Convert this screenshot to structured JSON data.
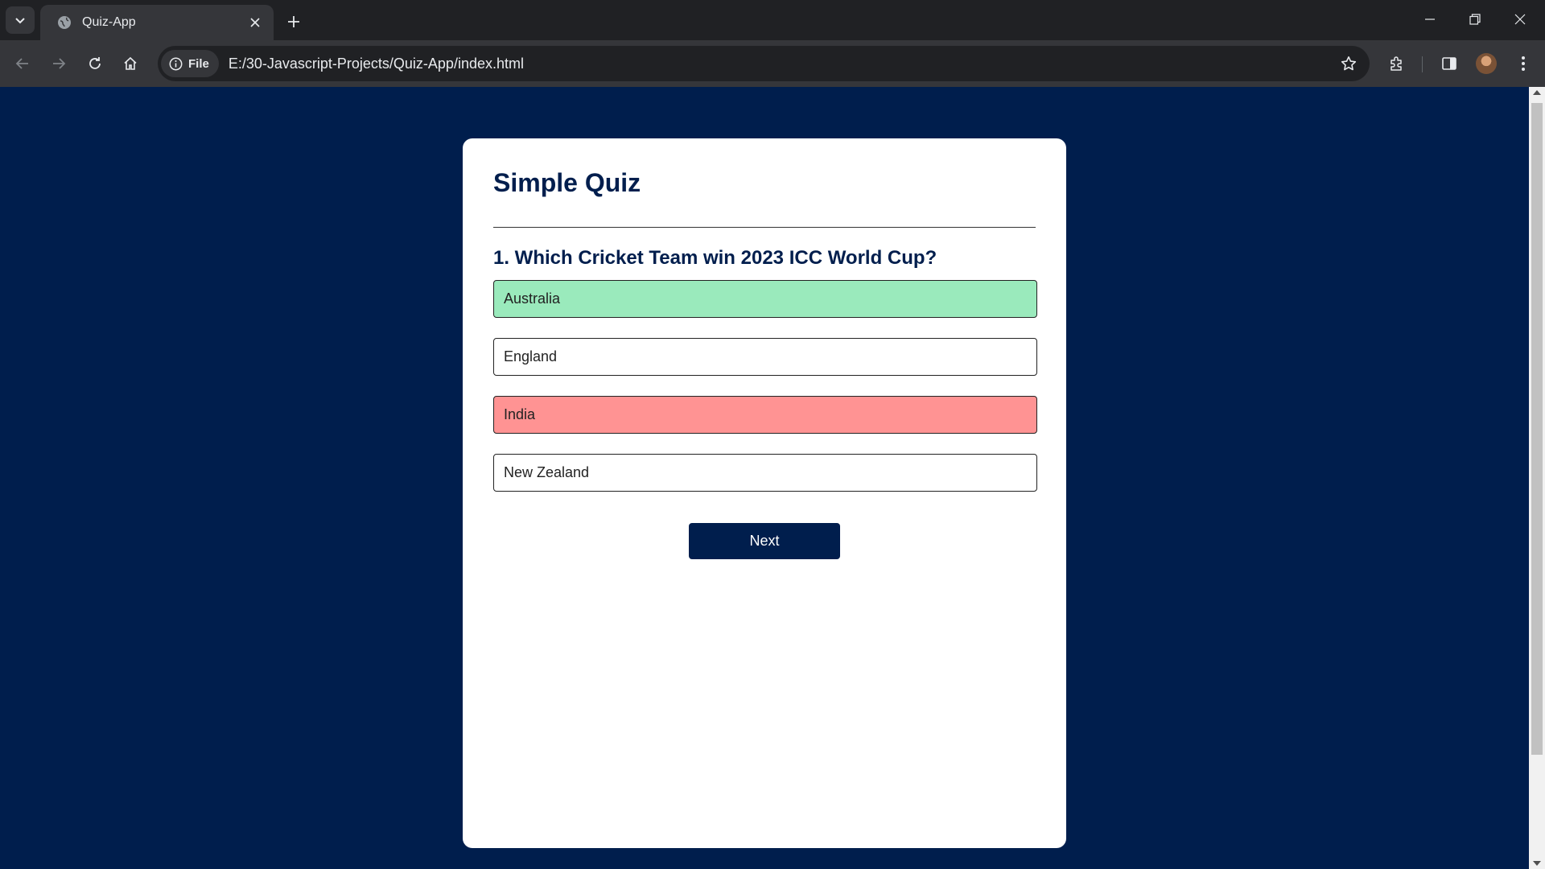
{
  "browser": {
    "tab_title": "Quiz-App",
    "security_chip": "File",
    "url": "E:/30-Javascript-Projects/Quiz-App/index.html"
  },
  "page": {
    "title": "Simple Quiz",
    "question": "1. Which Cricket Team win 2023 ICC World Cup?",
    "answers": [
      {
        "label": "Australia",
        "state": "correct"
      },
      {
        "label": "England",
        "state": "default"
      },
      {
        "label": "India",
        "state": "incorrect"
      },
      {
        "label": "New Zealand",
        "state": "default"
      }
    ],
    "next_label": "Next"
  },
  "colors": {
    "page_background": "#001e4d",
    "correct": "#9aeabc",
    "incorrect": "#ff9393",
    "button": "#001e4d"
  },
  "icons": [
    "tab-search-icon",
    "globe-icon",
    "close-icon",
    "plus-icon",
    "minimize-icon",
    "restore-icon",
    "window-close-icon",
    "back-arrow-icon",
    "forward-arrow-icon",
    "reload-icon",
    "home-icon",
    "info-icon",
    "star-icon",
    "extensions-icon",
    "side-panel-icon",
    "profile-avatar",
    "more-vert-icon"
  ]
}
